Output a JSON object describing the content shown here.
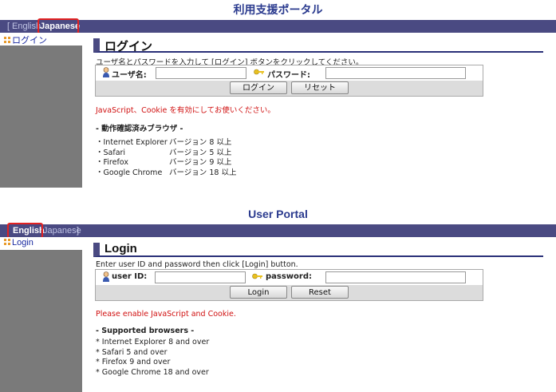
{
  "colors": {
    "title": "#2a3a8e",
    "langbar": "#4a4a82",
    "sidebar": "#7a7a7a",
    "warning": "#d01010",
    "highlight": "#e22222"
  },
  "jp": {
    "title": "利用支援ポータル",
    "lang": {
      "open_bracket": "[",
      "english": "English",
      "japanese": "Japanese"
    },
    "nav_login": "ログイン",
    "heading": "ログイン",
    "instruction": "ユーザ名とパスワードを入力して [ログイン] ボタンをクリックしてください。",
    "user_label": "ユーザ名:",
    "password_label": "パスワード:",
    "user_value": "",
    "password_value": "",
    "login_button": "ログイン",
    "reset_button": "リセット",
    "warning": "JavaScript、Cookie を有効にしてお使いください。",
    "browsers_heading": "- 動作確認済みブラウザ -",
    "browsers": [
      {
        "name": "・Internet Explorer",
        "version": "バージョン 8 以上"
      },
      {
        "name": "・Safari",
        "version": "バージョン 5 以上"
      },
      {
        "name": "・Firefox",
        "version": "バージョン 9 以上"
      },
      {
        "name": "・Google Chrome",
        "version": "バージョン 18 以上"
      }
    ]
  },
  "en": {
    "title": "User Portal",
    "lang": {
      "english": "English",
      "japanese": "Japanese",
      "close_bracket": "]"
    },
    "nav_login": "Login",
    "heading": "Login",
    "instruction": "Enter user ID and password then click [Login] button.",
    "user_label": "user ID:",
    "password_label": "password:",
    "user_value": "",
    "password_value": "",
    "login_button": "Login",
    "reset_button": "Reset",
    "warning": "Please enable JavaScript and Cookie.",
    "browsers_heading": "- Supported browsers -",
    "browsers": [
      "* Internet Explorer 8 and over",
      "* Safari 5 and over",
      "* Firefox 9 and over",
      "* Google Chrome 18 and over"
    ]
  }
}
